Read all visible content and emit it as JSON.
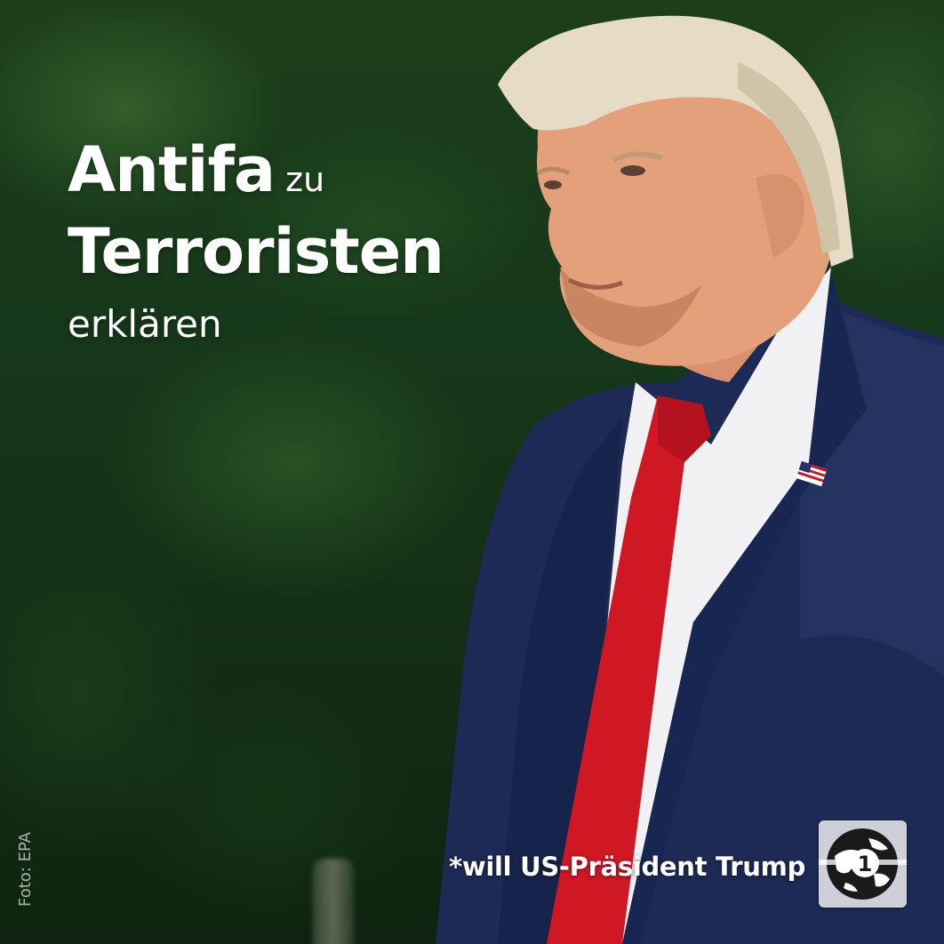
{
  "headline": {
    "word_antifa": "Antifa",
    "word_zu": "zu",
    "word_terroristen": "Terroristen",
    "word_erklaeren": "erklären"
  },
  "footnote": "*will US-Präsident Trump",
  "photo_credit": "Foto: EPA",
  "logo": {
    "icon": "tagesschau-globe-logo-icon",
    "numeral": "1"
  },
  "colors": {
    "background": "#1a3a1a",
    "suit": "#1c2a55",
    "tie": "#d01825",
    "text": "#ffffff"
  }
}
